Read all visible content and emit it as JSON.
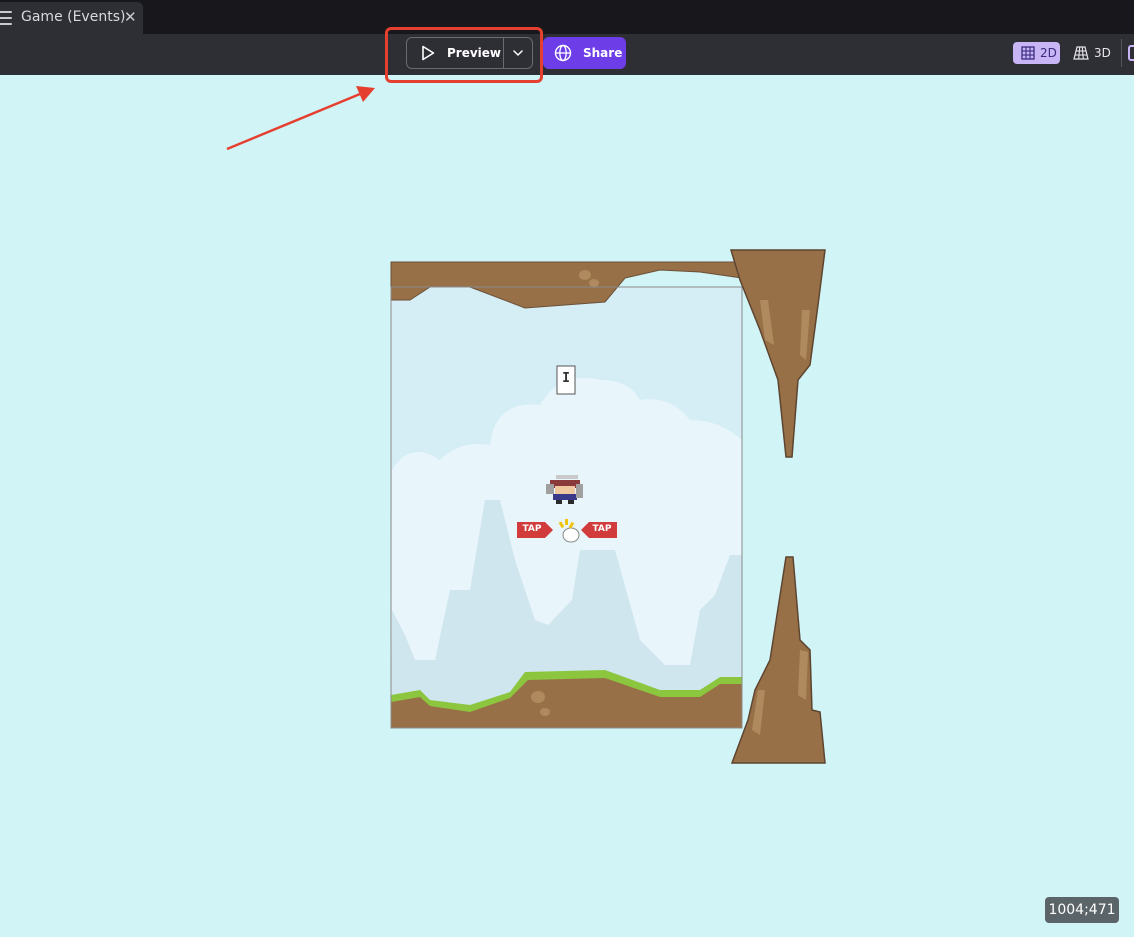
{
  "tab": {
    "title": "Game (Events)",
    "close_symbol": "✕",
    "icon": "menu-icon"
  },
  "toolbar": {
    "preview_label": "Preview",
    "share_label": "Share",
    "view_2d_label": "2D",
    "view_3d_label": "3D",
    "active_view": "2D"
  },
  "scene": {
    "score_text": "I",
    "tap_left_label": "TAP",
    "tap_right_label": "TAP"
  },
  "status": {
    "coordinates": "1004;471"
  },
  "colors": {
    "background": "#d1f4f7",
    "toolbar": "#2e2e35",
    "tabbar": "#17171c",
    "share_accent": "#6d3ee8",
    "highlight": "#e5402f",
    "dirt": "#987048",
    "grass": "#8cc63f",
    "tap_red": "#d23b3b"
  }
}
